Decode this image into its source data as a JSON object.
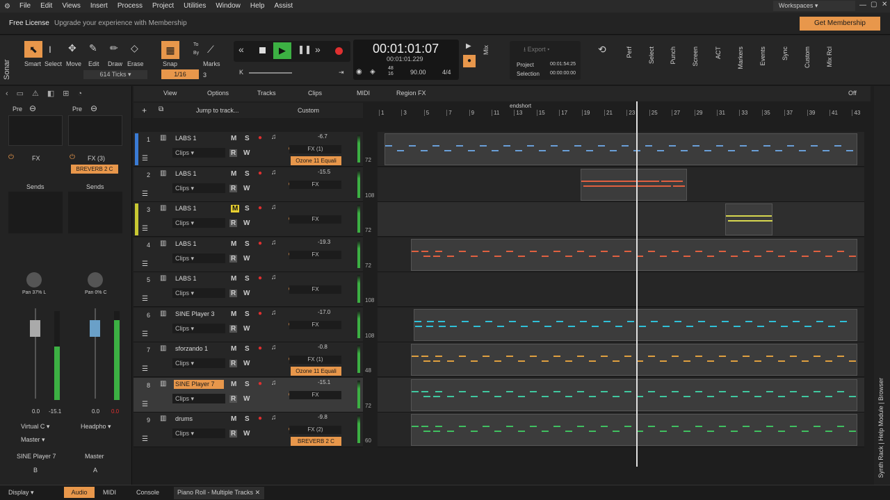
{
  "menu": {
    "items": [
      "File",
      "Edit",
      "Views",
      "Insert",
      "Process",
      "Project",
      "Utilities",
      "Window",
      "Help",
      "Assist"
    ],
    "workspaces": "Workspaces"
  },
  "license": {
    "label": "Free License",
    "upgrade": "Upgrade your experience with Membership",
    "button": "Get Membership"
  },
  "tools": {
    "items": [
      "Smart",
      "Select",
      "Move",
      "Edit",
      "Draw",
      "Erase"
    ],
    "snap": "Snap",
    "snap_value": "1/16",
    "snap_count": "3",
    "marks": "Marks",
    "ticks": "614 Ticks",
    "to": "To",
    "by": "By"
  },
  "transport": {
    "time": "00:01:01:07",
    "sub": "00:01:01.229",
    "tempo": "90.00",
    "meter": "4/4",
    "ts_top": "48",
    "ts_bot": "16"
  },
  "export": {
    "label": "Export",
    "project_label": "Project",
    "project_time": "00:01:54:25",
    "selection_label": "Selection",
    "selection_time": "00:00:00:00"
  },
  "modules": [
    "Perf",
    "Select",
    "Punch",
    "Screen",
    "ACT",
    "Markers",
    "Events",
    "Sync",
    "Custom",
    "Mix Rcl"
  ],
  "mix_label": "Mix",
  "viewbar": {
    "items": [
      "View",
      "Options",
      "Tracks",
      "Clips",
      "MIDI",
      "Region FX"
    ],
    "off": "Off"
  },
  "trackbar": {
    "jump": "Jump to track...",
    "custom": "Custom"
  },
  "ruler": {
    "marker": "endshort",
    "bars": [
      "1",
      "3",
      "5",
      "7",
      "9",
      "11",
      "13",
      "15",
      "17",
      "19",
      "21",
      "23",
      "25",
      "27",
      "29",
      "31",
      "33",
      "35",
      "37",
      "39",
      "41",
      "43"
    ]
  },
  "tracks": [
    {
      "n": "1",
      "name": "LABS 1",
      "vol": "-6.7",
      "fx": "FX (1)",
      "plugin": "Ozone 11 Equali",
      "lane": "72"
    },
    {
      "n": "2",
      "name": "LABS 1",
      "vol": "-15.5",
      "fx": "FX",
      "plugin": "",
      "lane": "108"
    },
    {
      "n": "3",
      "name": "LABS 1",
      "vol": "",
      "fx": "FX",
      "plugin": "",
      "lane": "72"
    },
    {
      "n": "4",
      "name": "LABS 1",
      "vol": "-19.3",
      "fx": "FX",
      "plugin": "",
      "lane": "72"
    },
    {
      "n": "5",
      "name": "LABS 1",
      "vol": "",
      "fx": "FX",
      "plugin": "",
      "lane": "108"
    },
    {
      "n": "6",
      "name": "SINE Player 3",
      "vol": "-17.0",
      "fx": "FX",
      "plugin": "",
      "lane": "108"
    },
    {
      "n": "7",
      "name": "sforzando 1",
      "vol": "-0.8",
      "fx": "FX (1)",
      "plugin": "Ozone 11 Equali",
      "lane": "48"
    },
    {
      "n": "8",
      "name": "SINE Player 7",
      "vol": "-15.1",
      "fx": "FX",
      "plugin": "",
      "lane": "72"
    },
    {
      "n": "9",
      "name": "drums",
      "vol": "-9.8",
      "fx": "FX (2)",
      "plugin": "BREVERB 2 C",
      "lane": "60"
    }
  ],
  "track_labels": {
    "clips": "Clips",
    "m": "M",
    "s": "S",
    "r": "R",
    "w": "W"
  },
  "strip1": {
    "pre": "Pre",
    "fx": "FX",
    "sends": "Sends",
    "pan": "Pan 37% L",
    "vol_l": "0.0",
    "vol_r": "-15.1",
    "input": "Virtual C",
    "output": "Master",
    "name": "SINE Player 7",
    "letter": "B"
  },
  "strip2": {
    "pre": "Pre",
    "fx": "FX (3)",
    "plugin": "BREVERB 2 C",
    "sends": "Sends",
    "pan": "Pan 0% C",
    "vol_l": "0.0",
    "vol_r": "0.0",
    "input": "Headpho",
    "output": "",
    "name": "Master",
    "letter": "A"
  },
  "bottom": {
    "display": "Display",
    "audio": "Audio",
    "midi": "MIDI",
    "console": "Console",
    "tab": "Piano Roll - Multiple Tracks"
  },
  "side": {
    "label": "Synth Rack | Help Module | Browser"
  },
  "colors": {
    "accent": "#e8974b",
    "playgreen": "#3cb043",
    "rec": "#e03030"
  }
}
